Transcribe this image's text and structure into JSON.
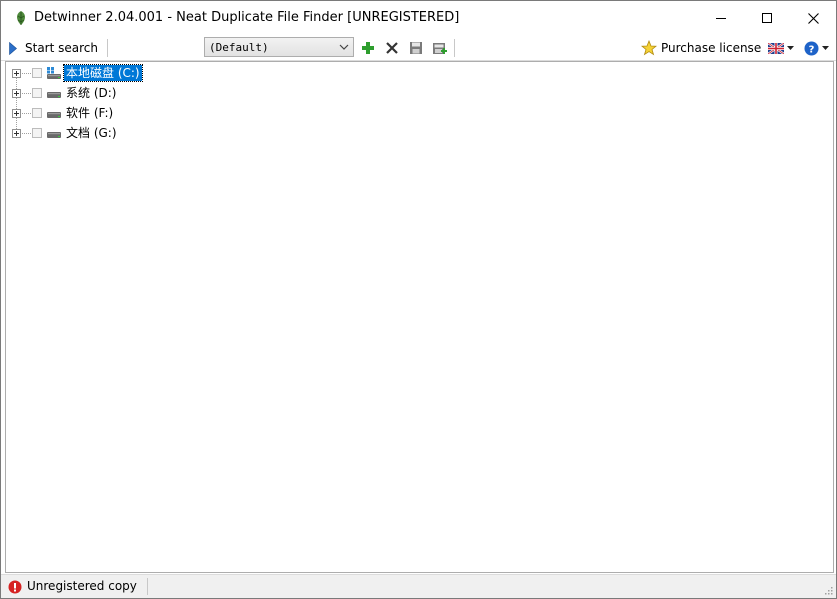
{
  "window": {
    "title": "Detwinner 2.04.001 - Neat Duplicate File Finder [UNREGISTERED]",
    "app_icon": "detwinner-app-icon"
  },
  "toolbar": {
    "start_search_label": "Start search",
    "profile": {
      "selected": "(Default)"
    },
    "icons": [
      "add-profile-icon",
      "delete-profile-icon",
      "save-profile-icon",
      "save-as-profile-icon"
    ],
    "purchase_label": "Purchase license",
    "language_icon": "uk-flag-icon",
    "help_icon": "help-icon"
  },
  "tree": {
    "items": [
      {
        "label": "本地磁盘 (C:)",
        "icon": "system-drive-icon",
        "selected": true,
        "checked": false
      },
      {
        "label": "系统 (D:)",
        "icon": "drive-icon",
        "selected": false,
        "checked": false
      },
      {
        "label": "软件 (F:)",
        "icon": "drive-icon",
        "selected": false,
        "checked": false
      },
      {
        "label": "文档 (G:)",
        "icon": "drive-icon",
        "selected": false,
        "checked": false
      }
    ]
  },
  "statusbar": {
    "text": "Unregistered copy",
    "icon": "error-icon"
  },
  "colors": {
    "selection": "#0078d7",
    "add_green": "#2e9e2e",
    "error_red": "#d62222",
    "help_blue": "#1e63c8",
    "play_blue": "#2b6fc9"
  }
}
